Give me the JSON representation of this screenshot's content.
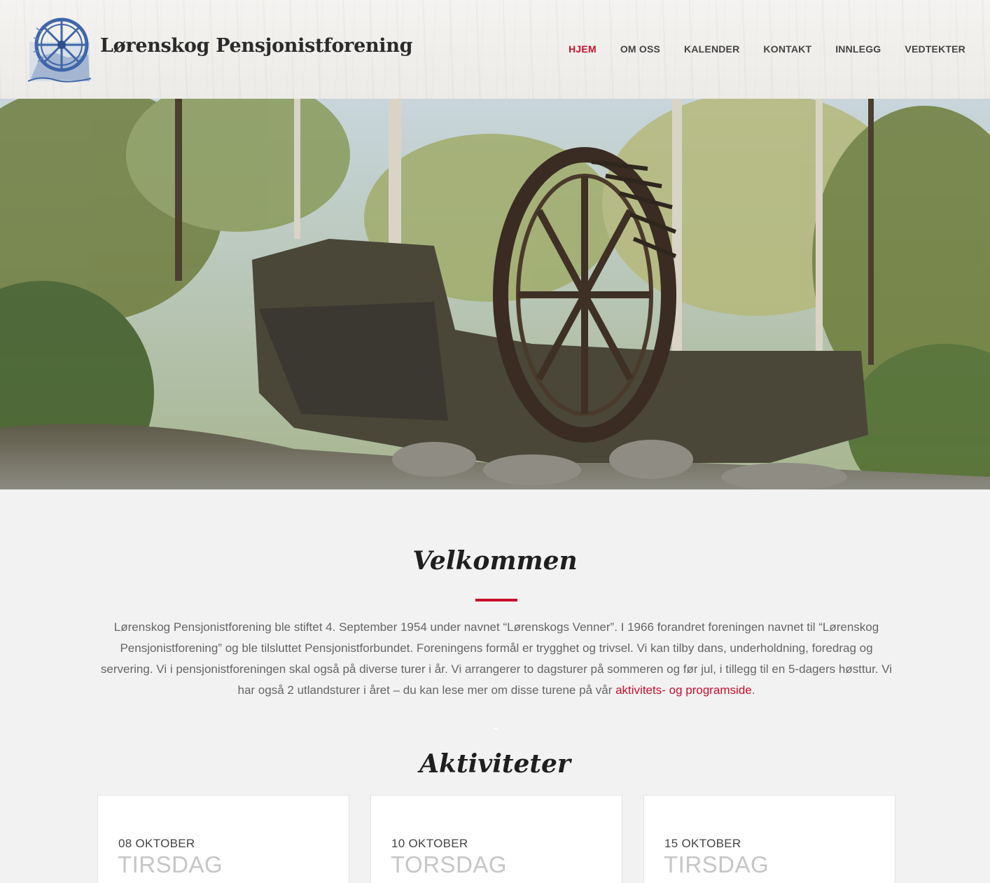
{
  "header": {
    "site_title": "Lørenskog Pensjonistforening",
    "logo_icon": "water-wheel-logo-icon",
    "nav": [
      {
        "label": "HJEM",
        "active": true
      },
      {
        "label": "OM OSS",
        "active": false
      },
      {
        "label": "KALENDER",
        "active": false
      },
      {
        "label": "KONTAKT",
        "active": false
      },
      {
        "label": "INNLEGG",
        "active": false
      },
      {
        "label": "VEDTEKTER",
        "active": false
      }
    ]
  },
  "welcome": {
    "title": "Velkommen",
    "text": "Lørenskog Pensjonistforening ble stiftet 4. September 1954 under navnet “Lørenskogs Venner”. I 1966 forandret foreningen navnet til “Lørenskog Pensjonistforening” og ble tilsluttet Pensjonistforbundet. Foreningens formål er trygghet og trivsel. Vi kan tilby dans, underholdning, foredrag og servering. Vi i pensjonistforeningen skal også på diverse turer i år. Vi arrangerer to dagsturer på sommeren og før jul, i tillegg til en 5-dagers høsttur. Vi har også 2 utlandsturer i året – du kan lese mer om disse turene på vår ",
    "link": "aktivitets- og programside",
    "text_end": "."
  },
  "activities": {
    "title": "Aktiviteter",
    "items": [
      {
        "date": "08 OKTOBER",
        "day": "TIRSDAG"
      },
      {
        "date": "10 OKTOBER",
        "day": "TORSDAG"
      },
      {
        "date": "15 OKTOBER",
        "day": "TIRSDAG"
      }
    ]
  },
  "colors": {
    "accent": "#c8102e",
    "background": "#f2f2f2"
  }
}
